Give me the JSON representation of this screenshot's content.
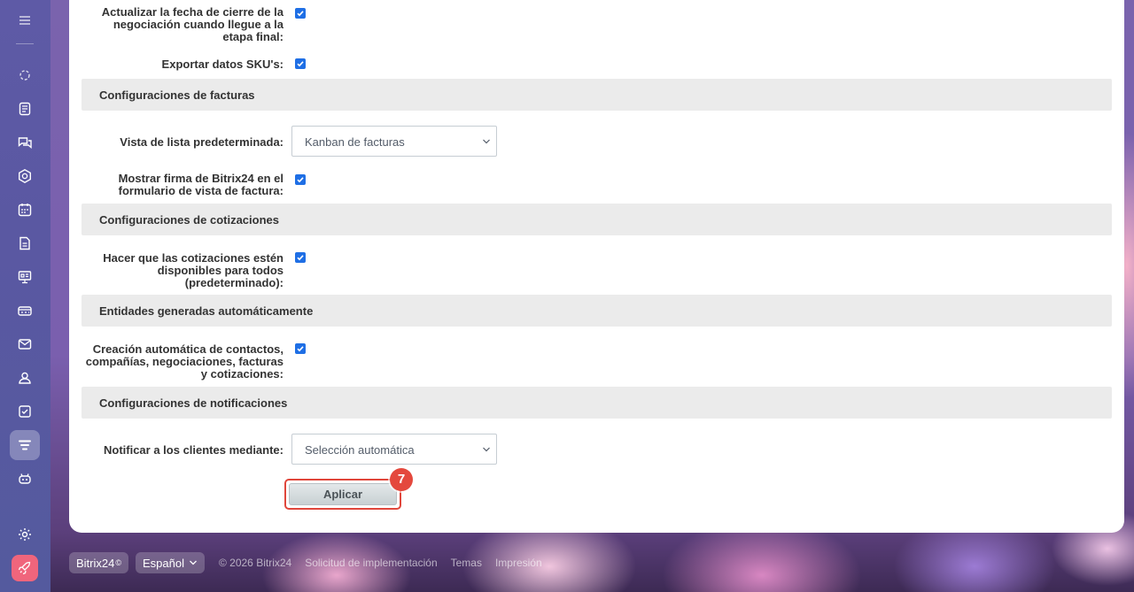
{
  "sidebar": {
    "items": [
      {
        "icon": "menu-icon"
      },
      {
        "icon": "feed-icon"
      },
      {
        "icon": "document-icon"
      },
      {
        "icon": "chat-icon"
      },
      {
        "icon": "hexagon-icon"
      },
      {
        "icon": "calendar-icon"
      },
      {
        "icon": "file-icon"
      },
      {
        "icon": "presentation-icon"
      },
      {
        "icon": "card-icon"
      },
      {
        "icon": "mail-icon"
      },
      {
        "icon": "contacts-icon"
      },
      {
        "icon": "tasks-icon"
      },
      {
        "icon": "crm-filter-icon",
        "active": true
      },
      {
        "icon": "robot-icon"
      },
      {
        "icon": "settings-icon"
      },
      {
        "icon": "rocket-icon"
      }
    ]
  },
  "settings": {
    "close_date_label_1": "Actualizar la fecha de cierre de la",
    "close_date_label_2": "negociación cuando llegue a la",
    "close_date_label_3": "etapa final:",
    "close_date_checked": true,
    "export_sku_label": "Exportar datos SKU's:",
    "export_sku_checked": true,
    "invoice_section": "Configuraciones de facturas",
    "default_list_view_label": "Vista de lista predeterminada:",
    "default_list_view_value": "Kanban de facturas",
    "signature_label_1": "Mostrar firma de Bitrix24 en el",
    "signature_label_2": "formulario de vista de factura:",
    "signature_checked": true,
    "quotes_section": "Configuraciones de cotizaciones",
    "quotes_label_1": "Hacer que las cotizaciones estén",
    "quotes_label_2": "disponibles para todos",
    "quotes_label_3": "(predeterminado):",
    "quotes_checked": true,
    "auto_entities_section": "Entidades generadas automáticamente",
    "auto_create_label_1": "Creación automática de contactos,",
    "auto_create_label_2": "compañías, negociaciones, facturas",
    "auto_create_label_3": "y cotizaciones:",
    "auto_create_checked": true,
    "notifications_section": "Configuraciones de notificaciones",
    "notify_label": "Notificar a los clientes mediante:",
    "notify_value": "Selección automática",
    "apply_label": "Aplicar",
    "step_number": "7"
  },
  "footer": {
    "brand": "Bitrix24",
    "brand_mark": "©",
    "language": "Español",
    "copyright": "© 2026 Bitrix24",
    "links": [
      "Solicitud de implementación",
      "Temas",
      "Impresión"
    ]
  }
}
